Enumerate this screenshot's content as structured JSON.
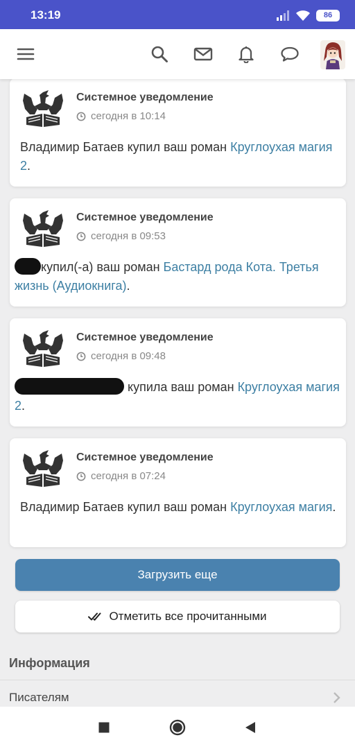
{
  "status_bar": {
    "time": "13:19",
    "battery": "86",
    "icons": [
      "signal-icon",
      "wifi-icon",
      "battery-icon"
    ]
  },
  "header": {
    "icons": [
      "menu-icon",
      "search-icon",
      "mail-icon",
      "bell-icon",
      "chat-icon",
      "avatar"
    ]
  },
  "notifications": [
    {
      "title": "Системное уведомление",
      "time": "сегодня в 10:14",
      "text": "Владимир Батаев купил ваш роман ",
      "link": "Круглоухая магия 2",
      "suffix": "."
    },
    {
      "title": "Системное уведомление",
      "time": "сегодня в 09:53",
      "text": "купил(-а) ваш роман ",
      "link": "Бастард рода Кота. Третья жизнь (Аудиокнига)",
      "suffix": "."
    },
    {
      "title": "Системное уведомление",
      "time": "сегодня в 09:48",
      "text": " купила ваш роман ",
      "link": "Круглоухая магия 2",
      "suffix": "."
    },
    {
      "title": "Системное уведомление",
      "time": "сегодня в 07:24",
      "text": "Владимир Батаев купил ваш роман ",
      "link": "Круглоухая магия",
      "suffix": "."
    }
  ],
  "buttons": {
    "load_more": "Загрузить еще",
    "mark_all_read": "Отметить все прочитанными"
  },
  "info": {
    "title": "Информация",
    "items": [
      "Писателям"
    ]
  },
  "colors": {
    "status_bar": "#4a53c9",
    "primary_button": "#4a82af",
    "link": "#3d7fa3"
  }
}
